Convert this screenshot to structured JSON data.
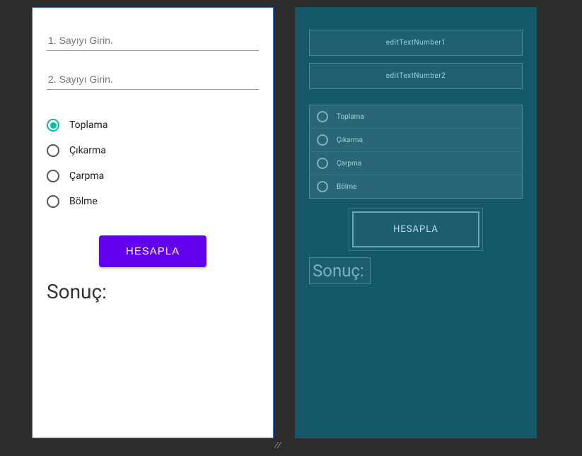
{
  "design": {
    "input1_placeholder": "1. Sayıyı Girin.",
    "input2_placeholder": "2. Sayıyı Girin.",
    "radios": [
      {
        "label": "Toplama",
        "selected": true
      },
      {
        "label": "Çıkarma",
        "selected": false
      },
      {
        "label": "Çarpma",
        "selected": false
      },
      {
        "label": "Bölme",
        "selected": false
      }
    ],
    "button_label": "HESAPLA",
    "result_label": "Sonuç:"
  },
  "blueprint": {
    "input1_id": "editTextNumber1",
    "input2_id": "editTextNumber2",
    "radios": [
      {
        "label": "Toplama"
      },
      {
        "label": "Çıkarma"
      },
      {
        "label": "Çarpma"
      },
      {
        "label": "Bölme"
      }
    ],
    "button_label": "HESAPLA",
    "result_label": "Sonuç:"
  },
  "colors": {
    "accent_primary": "#6200ee",
    "accent_radio": "#00bfa5",
    "blueprint_bg": "#15586a"
  }
}
